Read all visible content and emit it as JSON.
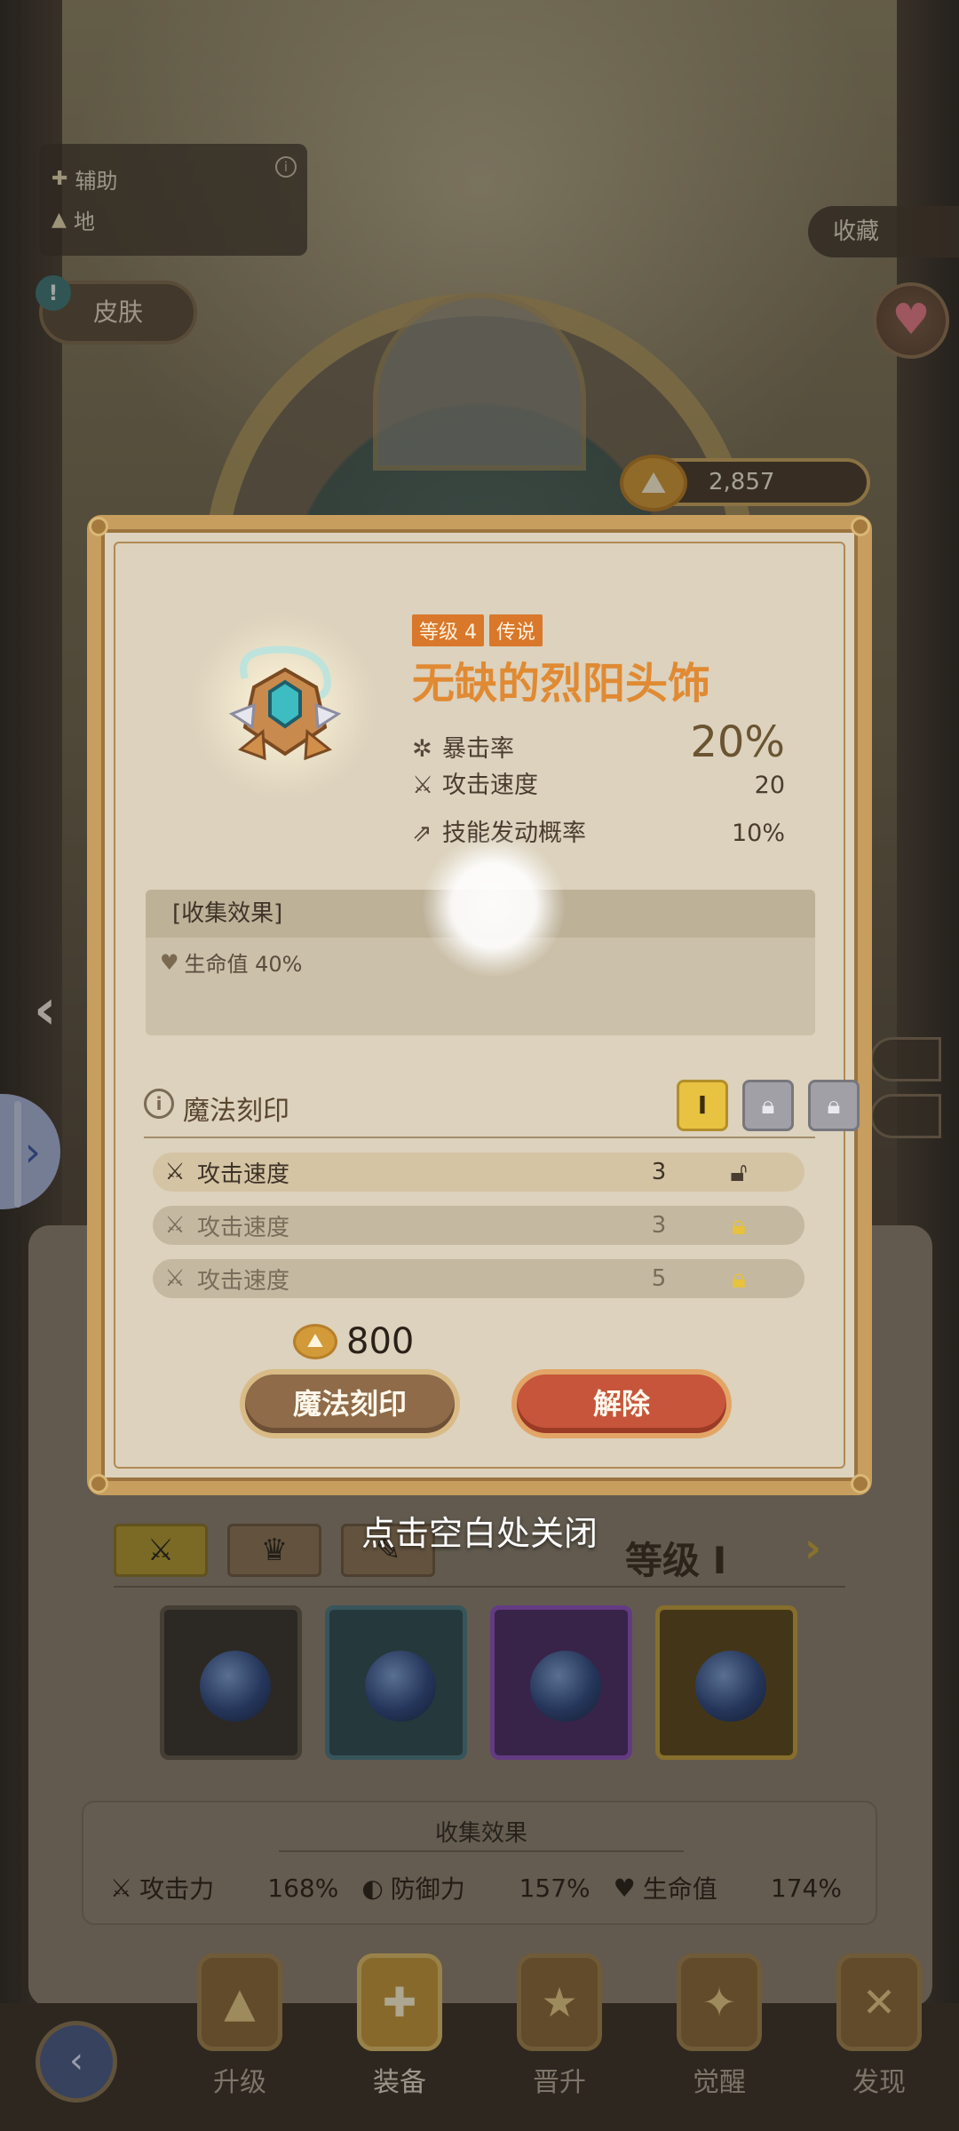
{
  "top_card": {
    "role": "辅助",
    "element": "地"
  },
  "skin_button": "皮肤",
  "collection_button": "收藏",
  "currency": {
    "amount": "2,857"
  },
  "modal": {
    "level_badge": "等级 4",
    "rarity_badge": "传说",
    "item_name": "无缺的烈阳头饰",
    "stats": [
      {
        "icon": "crit-icon",
        "label": "暴击率",
        "value": "20%"
      },
      {
        "icon": "attack-speed-icon",
        "label": "攻击速度",
        "value": "20"
      },
      {
        "icon": "skill-trigger-icon",
        "label": "技能发动概率",
        "value": "10%"
      }
    ],
    "collection_effect_title": "[收集效果]",
    "collection_effect_line": "生命值 40%",
    "magic_engrave_title": "魔法刻印",
    "slots": [
      "I",
      "lock",
      "lock"
    ],
    "runes": [
      {
        "label": "攻击速度",
        "value": "3",
        "lock": "unlocked"
      },
      {
        "label": "攻击速度",
        "value": "3",
        "lock": "locked"
      },
      {
        "label": "攻击速度",
        "value": "5",
        "lock": "locked"
      }
    ],
    "cost": "800",
    "engrave_button": "魔法刻印",
    "release_button": "解除"
  },
  "close_hint": "点击空白处关闭",
  "lower": {
    "level_label": "等级",
    "level_value": "I",
    "collection_title": "收集效果",
    "stats": [
      {
        "label": "攻击力",
        "value": "168%"
      },
      {
        "label": "防御力",
        "value": "157%"
      },
      {
        "label": "生命值",
        "value": "174%"
      }
    ]
  },
  "bottom_nav": [
    {
      "label": "升级",
      "active": false
    },
    {
      "label": "装备",
      "active": true
    },
    {
      "label": "晋升",
      "active": false
    },
    {
      "label": "觉醒",
      "active": false
    },
    {
      "label": "发现",
      "active": false
    }
  ],
  "colors": {
    "accent_orange": "#e08a33",
    "slot_gold": "#e8c241",
    "release_red": "#c6553b",
    "frame_gold": "#c79e5e"
  }
}
